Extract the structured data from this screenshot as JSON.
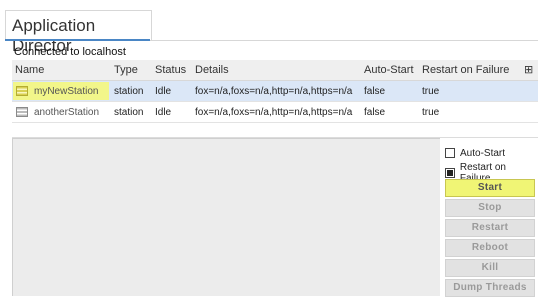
{
  "tab": {
    "title": "Application Director"
  },
  "connection": {
    "status": "Connected to localhost"
  },
  "table": {
    "columns": [
      "Name",
      "Type",
      "Status",
      "Details",
      "Auto-Start",
      "Restart on Failure"
    ],
    "rows": [
      {
        "name": "myNewStation",
        "type": "station",
        "status": "Idle",
        "details": "fox=n/a,foxs=n/a,http=n/a,https=n/a",
        "auto_start": "false",
        "restart_on_failure": "true"
      },
      {
        "name": "anotherStation",
        "type": "station",
        "status": "Idle",
        "details": "fox=n/a,foxs=n/a,http=n/a,https=n/a",
        "auto_start": "false",
        "restart_on_failure": "true"
      }
    ]
  },
  "options": {
    "auto_start": {
      "label": "Auto-Start",
      "checked": false
    },
    "restart_on_failure": {
      "label": "Restart on Failure",
      "checked": true
    }
  },
  "buttons": {
    "start": "Start",
    "stop": "Stop",
    "restart": "Restart",
    "reboot": "Reboot",
    "kill": "Kill",
    "dump_threads": "Dump Threads"
  },
  "colors": {
    "highlight": "#f0f575",
    "selection": "#dbe7f7",
    "tab_accent": "#4a86c5"
  }
}
